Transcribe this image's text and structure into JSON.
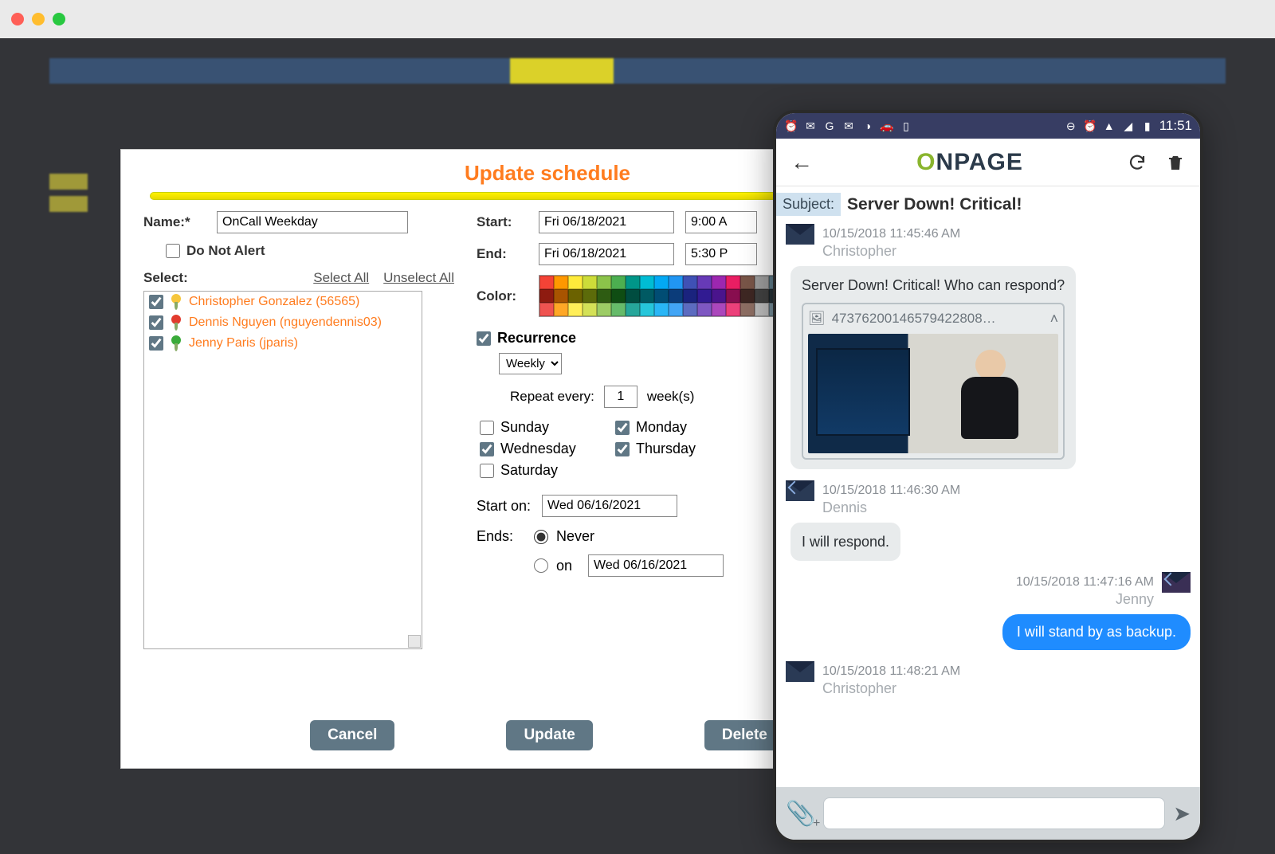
{
  "dialog": {
    "title": "Update schedule",
    "name_label": "Name:*",
    "name_value": "OnCall Weekday",
    "do_not_alert_label": "Do Not Alert",
    "do_not_alert_checked": false,
    "select_label": "Select:",
    "select_all": "Select All",
    "unselect_all": "Unselect All",
    "people": [
      {
        "name": "Christopher Gonzalez (56565)",
        "checked": true,
        "pin": "y"
      },
      {
        "name": "Dennis Nguyen (nguyendennis03)",
        "checked": true,
        "pin": "r"
      },
      {
        "name": "Jenny Paris (jparis)",
        "checked": true,
        "pin": "g"
      }
    ],
    "start_label": "Start:",
    "start_date": "Fri 06/18/2021",
    "start_time": "9:00 A",
    "end_label": "End:",
    "end_date": "Fri 06/18/2021",
    "end_time": "5:30 P",
    "color_label": "Color:",
    "swatch_colors": [
      "#f44336",
      "#ff9800",
      "#ffeb3b",
      "#cddc39",
      "#8bc34a",
      "#4caf50",
      "#009688",
      "#00bcd4",
      "#03a9f4",
      "#2196f3",
      "#3f51b5",
      "#673ab7",
      "#9c27b0",
      "#e91e63",
      "#795548",
      "#9e9e9e",
      "#607d8b",
      "#000000",
      "#8e1b10",
      "#a85400",
      "#6b6200",
      "#5c6b0a",
      "#2e5c12",
      "#0f4d13",
      "#004d40",
      "#005a63",
      "#014d74",
      "#0b3c7a",
      "#1a237e",
      "#311b92",
      "#4a148c",
      "#880e4f",
      "#3e2723",
      "#424242",
      "#263238",
      "#ffffff",
      "#ef5350",
      "#ffa726",
      "#ffee58",
      "#d4e157",
      "#9ccc65",
      "#66bb6a",
      "#26a69a",
      "#26c6da",
      "#29b6f6",
      "#42a5f5",
      "#5c6bc0",
      "#7e57c2",
      "#ab47bc",
      "#ec407a",
      "#8d6e63",
      "#bdbdbd",
      "#78909c",
      "#c0c0c0"
    ],
    "recurrence_label": "Recurrence",
    "recurrence_checked": true,
    "freq_value": "Weekly",
    "repeat_label": "Repeat every:",
    "repeat_value": "1",
    "repeat_unit": "week(s)",
    "days": [
      {
        "label": "Sunday",
        "checked": false
      },
      {
        "label": "Monday",
        "checked": true
      },
      {
        "label": "Wednesday",
        "checked": true
      },
      {
        "label": "Thursday",
        "checked": true
      },
      {
        "label": "Saturday",
        "checked": false
      }
    ],
    "start_on_label": "Start on:",
    "start_on_value": "Wed 06/16/2021",
    "ends_label": "Ends:",
    "ends_never_label": "Never",
    "ends_on_label": "on",
    "ends_on_value": "Wed 06/16/2021",
    "ends_selected": "never",
    "btn_cancel": "Cancel",
    "btn_update": "Update",
    "btn_delete": "Delete"
  },
  "phone": {
    "status_time": "11:51",
    "logo_text_1": "O",
    "logo_text_2": "NPAGE",
    "subject_label": "Subject:",
    "subject_text": "Server Down! Critical!",
    "messages": [
      {
        "side": "left",
        "time": "10/15/2018 11:45:46 AM",
        "name": "Christopher",
        "text": "Server Down! Critical! Who can respond?",
        "attachment": "47376200146579422808…"
      },
      {
        "side": "left",
        "time": "10/15/2018 11:46:30 AM",
        "name": "Dennis",
        "text": "I will respond."
      },
      {
        "side": "right",
        "time": "10/15/2018 11:47:16 AM",
        "name": "Jenny",
        "text": "I will stand by as backup."
      },
      {
        "side": "left",
        "time": "10/15/2018 11:48:21 AM",
        "name": "Christopher",
        "text": ""
      }
    ]
  }
}
